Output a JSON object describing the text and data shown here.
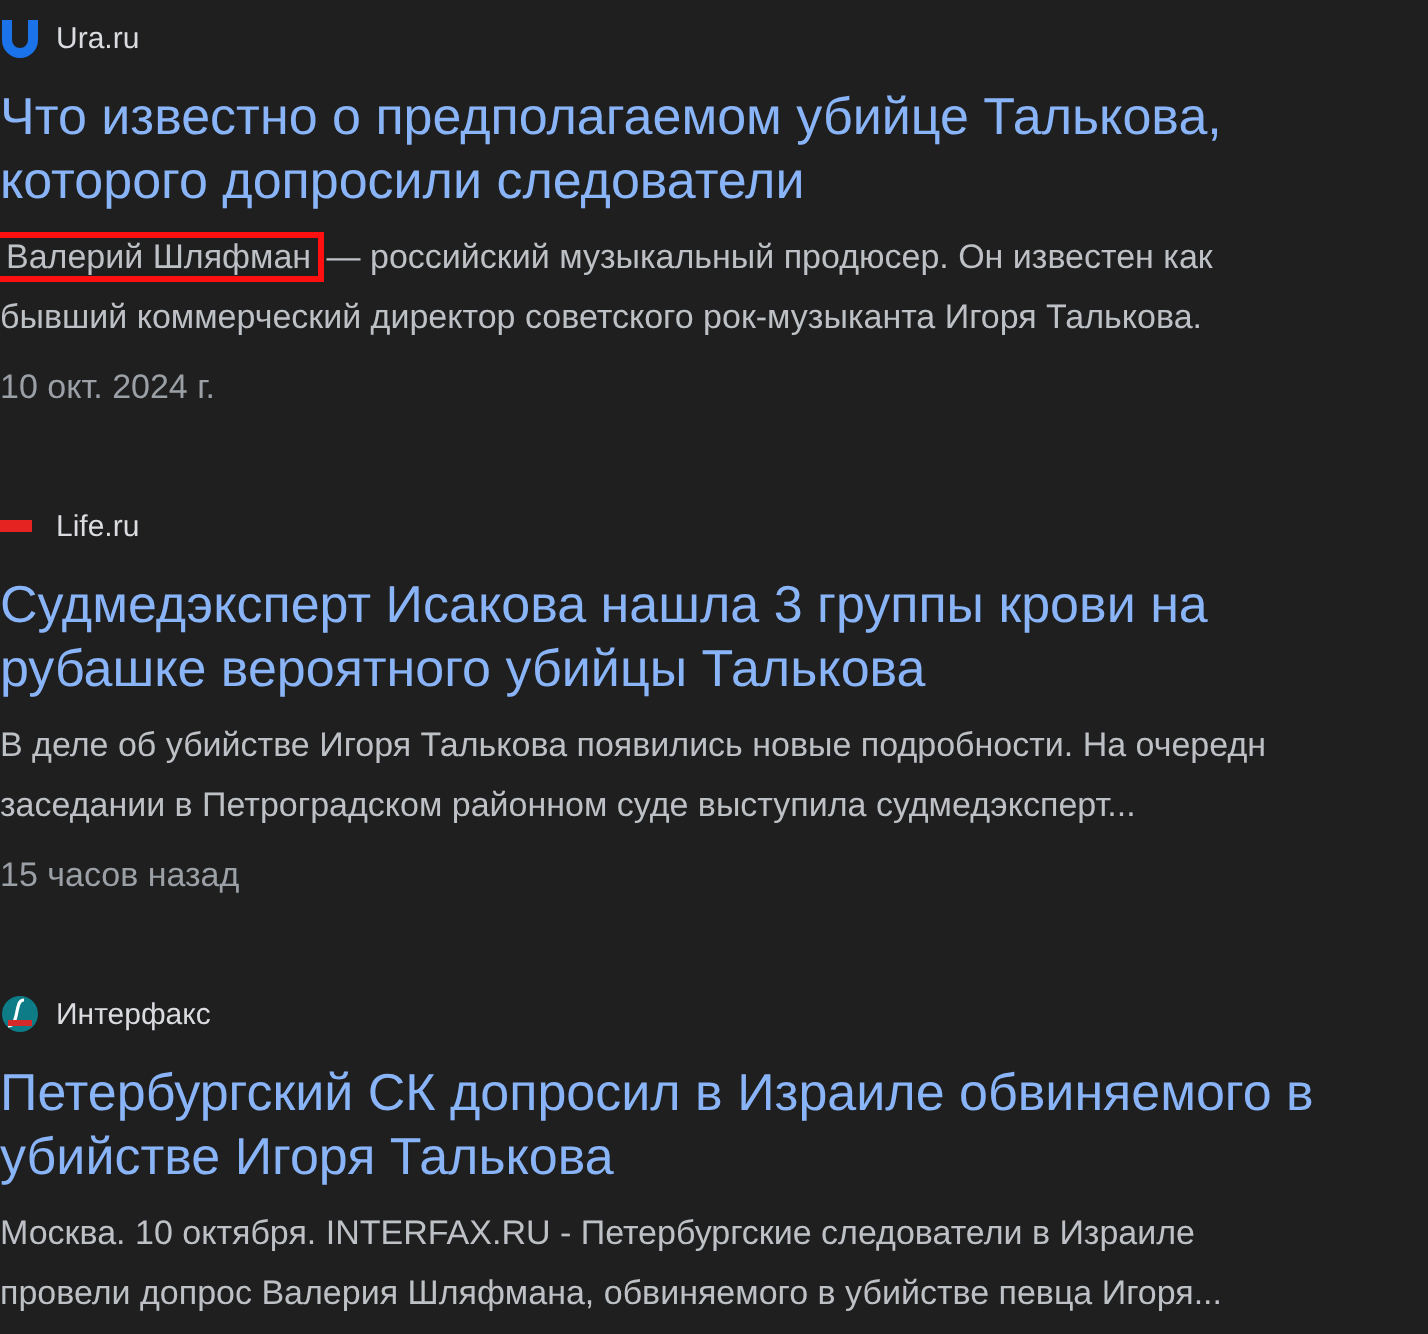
{
  "results": [
    {
      "source": {
        "kind": "ura",
        "name": "Ura.ru"
      },
      "title_lines": [
        "Что известно о предполагаемом убийце Талькова,",
        "которого допросили следователи"
      ],
      "snippet_lines": [
        {
          "highlight": "Валерий Шляфман",
          "text": " — российский музыкальный продюсер. Он известен как"
        },
        {
          "text": "бывший коммерческий директор советского рок-музыканта Игоря Талькова."
        }
      ],
      "date": "10 окт. 2024 г."
    },
    {
      "source": {
        "kind": "life",
        "name": "Life.ru"
      },
      "title_lines": [
        "Судмедэксперт Исакова нашла 3 группы крови на",
        "рубашке вероятного убийцы Талькова"
      ],
      "snippet_lines": [
        {
          "text": "В деле об убийстве Игоря Талькова появились новые подробности. На очередн"
        },
        {
          "text": "заседании в Петроградском районном суде выступила судмедэксперт..."
        }
      ],
      "date": "15 часов назад"
    },
    {
      "source": {
        "kind": "interfax",
        "name": "Интерфакс"
      },
      "title_lines": [
        "Петербургский СК допросил в Израиле обвиняемого в",
        "убийстве Игоря Талькова"
      ],
      "snippet_lines": [
        {
          "text": "Москва. 10 октября. INTERFAX.RU - Петербургские следователи в Израиле"
        },
        {
          "text": "провели допрос Валерия Шляфмана, обвиняемого в убийстве певца Игоря..."
        }
      ]
    }
  ]
}
